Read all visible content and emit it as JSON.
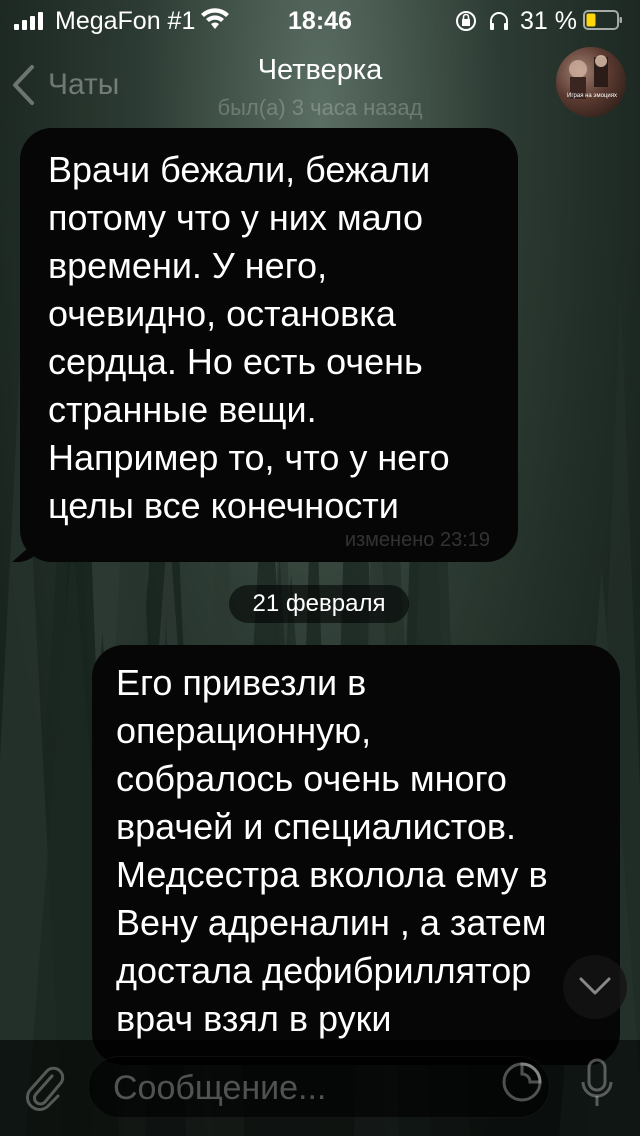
{
  "status_bar": {
    "carrier": "MegaFon #1",
    "time": "18:46",
    "battery_percent": "31 %",
    "battery_level": 0.31
  },
  "header": {
    "back_label": "Чаты",
    "title": "Четверка",
    "status": "был(а) 3 часа назад",
    "avatar_caption": "Играя на эмоциях"
  },
  "messages": [
    {
      "text": "Врачи бежали, бежали\nпотому что у них мало\nвремени. У него,\nочевидно, остановка\nсердца. Но есть очень\nстранные вещи.\nНапример то, что у него\nцелы все конечности",
      "meta": "изменено 23:19"
    },
    {
      "text": "Его привезли в\nоперационную,\nсобралось очень много\nврачей и специалистов.\nМедсестра вколола ему в\nВену адреналин , а затем\nдостала дефибриллятор\nврач взял в руки"
    }
  ],
  "date_separator": "21 февраля",
  "composer": {
    "placeholder": "Сообщение..."
  },
  "colors": {
    "bubble": "#060606",
    "text": "#ffffff"
  }
}
